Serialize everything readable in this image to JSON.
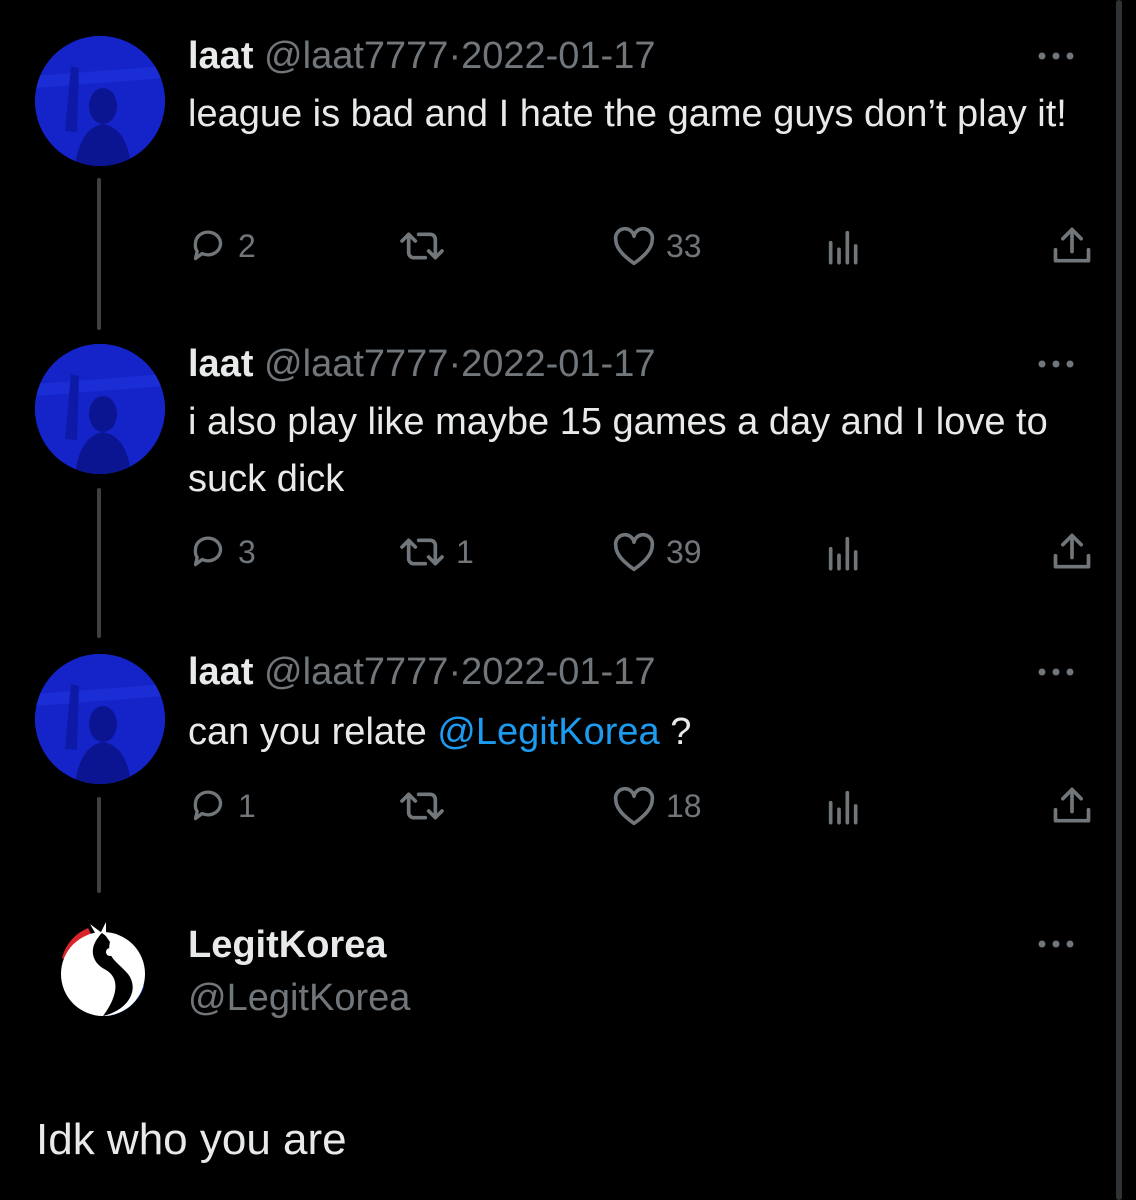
{
  "tweets": [
    {
      "name": "laat",
      "handle": "@laat7777",
      "sep": "·",
      "date": "2022-01-17",
      "text": "league is bad and I hate the game guys don’t play it!",
      "mention": "",
      "after": "",
      "replies": "2",
      "retweets": "",
      "likes": "33"
    },
    {
      "name": "laat",
      "handle": "@laat7777",
      "sep": "·",
      "date": "2022-01-17",
      "text": "i also play like maybe 15 games a day and I love to suck dick",
      "mention": "",
      "after": "",
      "replies": "3",
      "retweets": "1",
      "likes": "39"
    },
    {
      "name": "laat",
      "handle": "@laat7777",
      "sep": "·",
      "date": "2022-01-17",
      "text": "can you relate ",
      "mention": "@LegitKorea",
      "after": " ?",
      "replies": "1",
      "retweets": "",
      "likes": "18"
    }
  ],
  "main_tweet": {
    "name": "LegitKorea",
    "handle": "@LegitKorea",
    "text": "Idk who you are"
  },
  "icons": {
    "reply": "speech-bubble-icon",
    "retweet": "retweet-icon",
    "like": "heart-icon",
    "views": "bar-chart-icon",
    "share": "share-upload-icon",
    "more": "ellipsis-icon"
  },
  "colors": {
    "background": "#000000",
    "text": "#e7e9ea",
    "muted": "#71767b",
    "link": "#1d9bf0",
    "avatar_blue": "#1524c8"
  }
}
